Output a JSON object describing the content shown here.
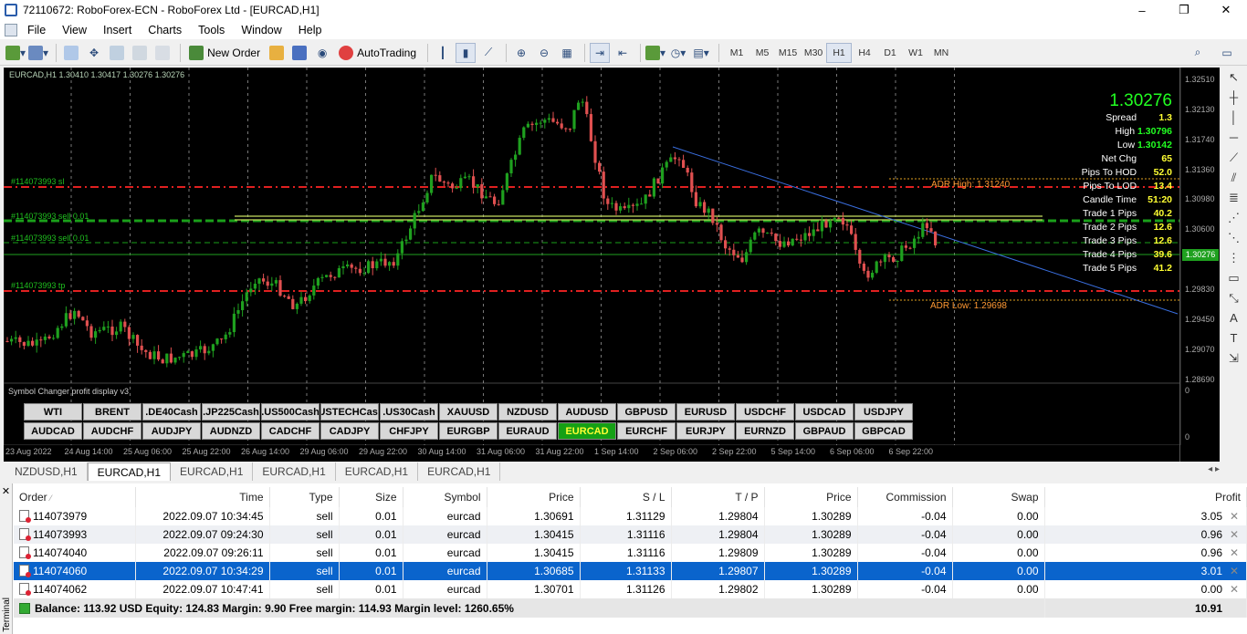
{
  "window": {
    "title": "72110672: RoboForex-ECN - RoboForex Ltd - [EURCAD,H1]",
    "controls": [
      "–",
      "❐",
      "✕"
    ]
  },
  "menu": [
    "File",
    "View",
    "Insert",
    "Charts",
    "Tools",
    "Window",
    "Help"
  ],
  "toolbar": {
    "new_order": "New Order",
    "autotrading": "AutoTrading",
    "timeframes": [
      "M1",
      "M5",
      "M15",
      "M30",
      "H1",
      "H4",
      "D1",
      "W1",
      "MN"
    ],
    "active_timeframe": "H1"
  },
  "chart": {
    "header": "EURCAD,H1  1.30410 1.30417 1.30276 1.30276",
    "current_price": "1.30276",
    "order_lines": [
      {
        "label": "#114073993 sl"
      },
      {
        "label": "#114073993 sell 0.01"
      },
      {
        "label": "#114073993 sell 0.01"
      },
      {
        "label": "#114073993 tp"
      }
    ],
    "info": {
      "price": "1.30276",
      "rows": [
        {
          "label": "Spread",
          "value": "1.3"
        },
        {
          "label": "High",
          "value": "1.30796"
        },
        {
          "label": "Low",
          "value": "1.30142"
        },
        {
          "label": "Net Chg",
          "value": "65"
        },
        {
          "label": "Pips To HOD",
          "value": "52.0"
        },
        {
          "label": "Pips To LOD",
          "value": "13.4"
        },
        {
          "label": "Candle Time",
          "value": "51:20"
        },
        {
          "label": "Trade 1 Pips",
          "value": "40.2"
        },
        {
          "label": "Trade 2 Pips",
          "value": "12.6"
        },
        {
          "label": "Trade 3 Pips",
          "value": "12.6"
        },
        {
          "label": "Trade 4 Pips",
          "value": "39.6"
        },
        {
          "label": "Trade 5 Pips",
          "value": "41.2"
        }
      ]
    },
    "adr_high": "ADR High: 1.31240",
    "adr_low": "ADR Low: 1.29698",
    "indicator_title": "Symbol Changer profit display v3",
    "symbols_row1": [
      "WTI",
      "BRENT",
      ".DE40Cash",
      ".JP225Cash",
      ".US500Cash",
      ".USTECHCash",
      ".US30Cash",
      "XAUUSD",
      "NZDUSD",
      "AUDUSD",
      "GBPUSD",
      "EURUSD",
      "USDCHF",
      "USDCAD",
      "USDJPY"
    ],
    "symbols_row2": [
      "AUDCAD",
      "AUDCHF",
      "AUDJPY",
      "AUDNZD",
      "CADCHF",
      "CADJPY",
      "CHFJPY",
      "EURGBP",
      "EURAUD",
      "EURCAD",
      "EURCHF",
      "EURJPY",
      "EURNZD",
      "GBPAUD",
      "GBPCAD"
    ],
    "active_symbol": "EURCAD",
    "x_labels": [
      "23 Aug 2022",
      "24 Aug 14:00",
      "25 Aug 06:00",
      "25 Aug 22:00",
      "26 Aug 14:00",
      "29 Aug 06:00",
      "29 Aug 22:00",
      "30 Aug 14:00",
      "31 Aug 06:00",
      "31 Aug 22:00",
      "1 Sep 14:00",
      "2 Sep 06:00",
      "2 Sep 22:00",
      "5 Sep 14:00",
      "6 Sep 06:00",
      "6 Sep 22:00"
    ],
    "y_labels": [
      "1.32510",
      "1.32130",
      "1.31740",
      "1.31360",
      "1.30980",
      "1.30600",
      "1.30276",
      "1.29830",
      "1.29450",
      "1.29070",
      "1.28690",
      "0",
      "0"
    ]
  },
  "chart_tabs": [
    "NZDUSD,H1",
    "EURCAD,H1",
    "EURCAD,H1",
    "EURCAD,H1",
    "EURCAD,H1",
    "EURCAD,H1"
  ],
  "active_chart_tab": 1,
  "terminal": {
    "label": "Terminal",
    "columns": [
      "Order",
      "Time",
      "Type",
      "Size",
      "Symbol",
      "Price",
      "S / L",
      "T / P",
      "Price",
      "Commission",
      "Swap",
      "Profit"
    ],
    "rows": [
      {
        "order": "114073979",
        "time": "2022.09.07 10:34:45",
        "type": "sell",
        "size": "0.01",
        "symbol": "eurcad",
        "price": "1.30691",
        "sl": "1.31129",
        "tp": "1.29804",
        "cur": "1.30289",
        "commission": "-0.04",
        "swap": "0.00",
        "profit": "3.05"
      },
      {
        "order": "114073993",
        "time": "2022.09.07 09:24:30",
        "type": "sell",
        "size": "0.01",
        "symbol": "eurcad",
        "price": "1.30415",
        "sl": "1.31116",
        "tp": "1.29804",
        "cur": "1.30289",
        "commission": "-0.04",
        "swap": "0.00",
        "profit": "0.96"
      },
      {
        "order": "114074040",
        "time": "2022.09.07 09:26:11",
        "type": "sell",
        "size": "0.01",
        "symbol": "eurcad",
        "price": "1.30415",
        "sl": "1.31116",
        "tp": "1.29809",
        "cur": "1.30289",
        "commission": "-0.04",
        "swap": "0.00",
        "profit": "0.96"
      },
      {
        "order": "114074060",
        "time": "2022.09.07 10:34:29",
        "type": "sell",
        "size": "0.01",
        "symbol": "eurcad",
        "price": "1.30685",
        "sl": "1.31133",
        "tp": "1.29807",
        "cur": "1.30289",
        "commission": "-0.04",
        "swap": "0.00",
        "profit": "3.01"
      },
      {
        "order": "114074062",
        "time": "2022.09.07 10:47:41",
        "type": "sell",
        "size": "0.01",
        "symbol": "eurcad",
        "price": "1.30701",
        "sl": "1.31126",
        "tp": "1.29802",
        "cur": "1.30289",
        "commission": "-0.04",
        "swap": "0.00",
        "profit": "0.00"
      }
    ],
    "selected_row": 3,
    "balance_text": "Balance: 113.92 USD  Equity: 124.83  Margin: 9.90  Free margin: 114.93  Margin level: 1260.65%",
    "total_profit": "10.91"
  },
  "colors": {
    "chart_bg": "#000000",
    "bull": "#1fa01f",
    "bear": "#e05050",
    "accent": "#0a64cc"
  }
}
